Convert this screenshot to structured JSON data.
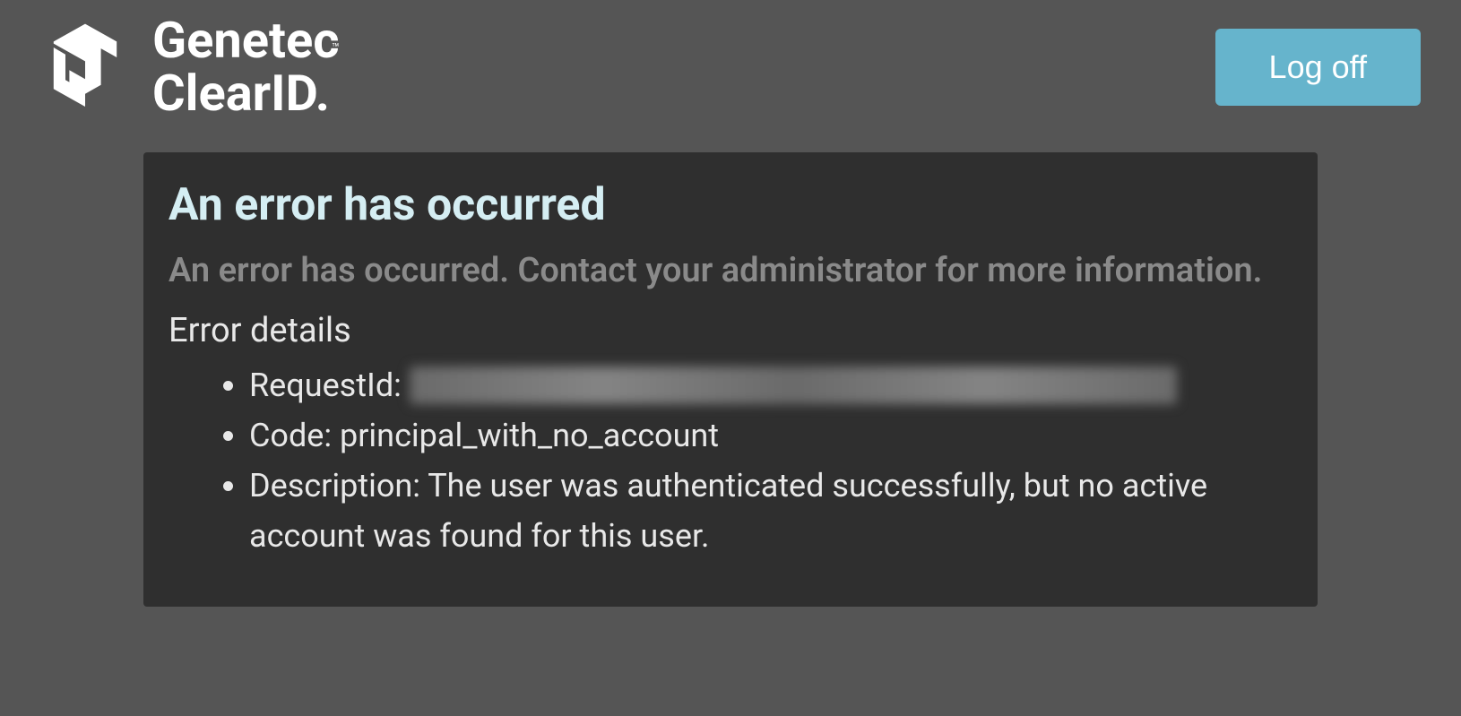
{
  "header": {
    "brand_line1": "Genetec",
    "brand_line2": "ClearID.",
    "logoff_label": "Log off"
  },
  "error": {
    "title": "An error has occurred",
    "subtitle": "An error has occurred. Contact your administrator for more information.",
    "details_heading": "Error details",
    "request_id_label": "RequestId:",
    "request_id_value": "████████-████-████-████-████████████",
    "code_label": "Code:",
    "code_value": "principal_with_no_account",
    "description_label": "Description:",
    "description_value": "The user was authenticated successfully, but no active account was found for this user."
  }
}
